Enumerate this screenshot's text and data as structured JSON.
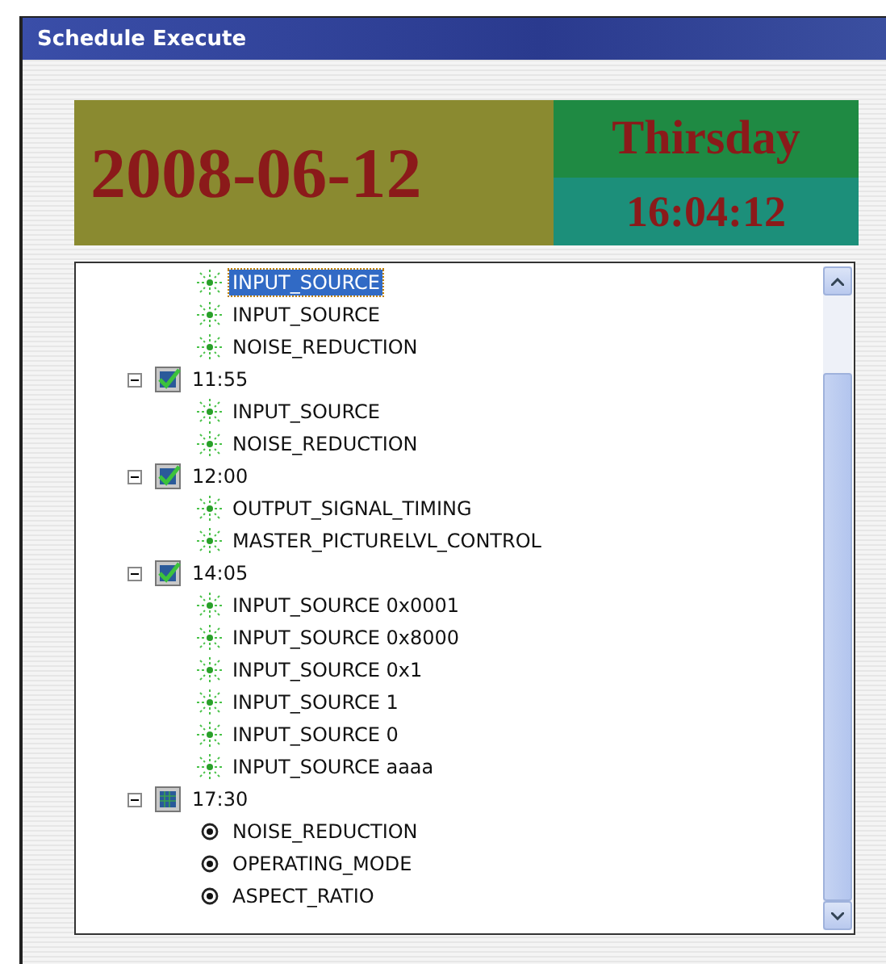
{
  "window": {
    "title": "Schedule Execute"
  },
  "clock": {
    "date": "2008-06-12",
    "weekday": "Thirsday",
    "time": "16:04:12"
  },
  "tree": {
    "leading_items": [
      {
        "label": "INPUT_SOURCE",
        "kind": "pending",
        "selected": true
      },
      {
        "label": "INPUT_SOURCE",
        "kind": "pending",
        "selected": false
      },
      {
        "label": "NOISE_REDUCTION",
        "kind": "pending",
        "selected": false
      }
    ],
    "groups": [
      {
        "label": "11:55",
        "checked": true,
        "expanded": true,
        "children": [
          {
            "label": "INPUT_SOURCE",
            "kind": "pending",
            "selected": false
          },
          {
            "label": "NOISE_REDUCTION",
            "kind": "pending",
            "selected": false
          }
        ]
      },
      {
        "label": "12:00",
        "checked": true,
        "expanded": true,
        "children": [
          {
            "label": "OUTPUT_SIGNAL_TIMING",
            "kind": "pending",
            "selected": false
          },
          {
            "label": "MASTER_PICTURELVL_CONTROL",
            "kind": "pending",
            "selected": false
          }
        ]
      },
      {
        "label": "14:05",
        "checked": true,
        "expanded": true,
        "children": [
          {
            "label": "INPUT_SOURCE 0x0001",
            "kind": "pending",
            "selected": false
          },
          {
            "label": "INPUT_SOURCE 0x8000",
            "kind": "pending",
            "selected": false
          },
          {
            "label": "INPUT_SOURCE 0x1",
            "kind": "pending",
            "selected": false
          },
          {
            "label": "INPUT_SOURCE 1",
            "kind": "pending",
            "selected": false
          },
          {
            "label": "INPUT_SOURCE 0",
            "kind": "pending",
            "selected": false
          },
          {
            "label": "INPUT_SOURCE aaaa",
            "kind": "pending",
            "selected": false
          }
        ]
      },
      {
        "label": "17:30",
        "checked": false,
        "expanded": true,
        "children": [
          {
            "label": "NOISE_REDUCTION",
            "kind": "radio",
            "selected": false
          },
          {
            "label": "OPERATING_MODE",
            "kind": "radio",
            "selected": false
          },
          {
            "label": "ASPECT_RATIO",
            "kind": "radio",
            "selected": false
          }
        ]
      }
    ]
  }
}
